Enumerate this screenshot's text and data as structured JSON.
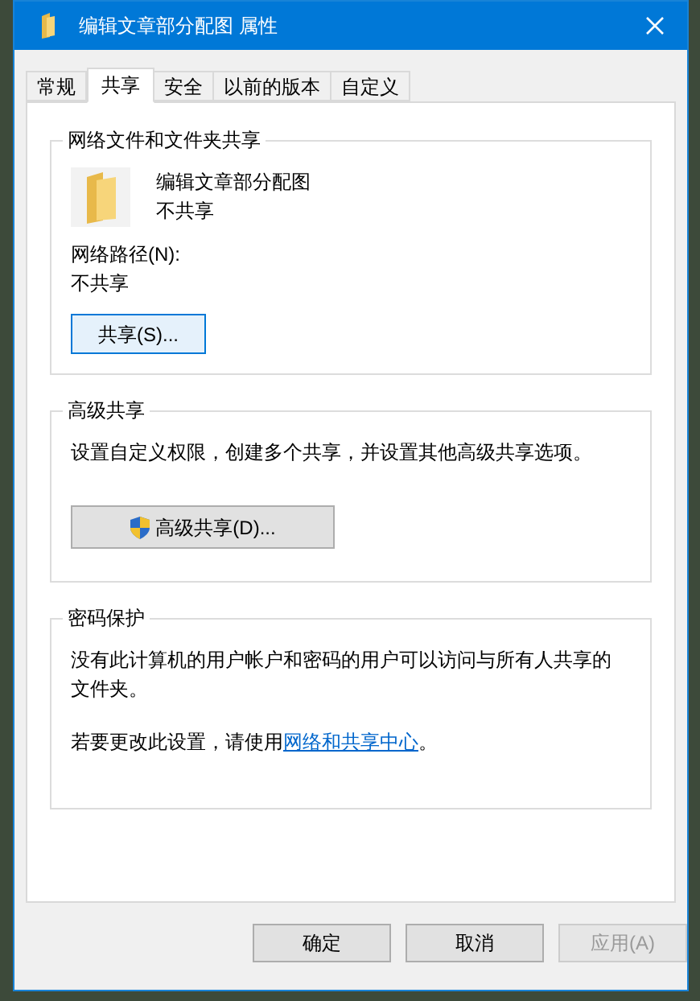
{
  "window": {
    "title": "编辑文章部分配图 属性"
  },
  "tabs": [
    {
      "label": "常规",
      "selected": false
    },
    {
      "label": "共享",
      "selected": true
    },
    {
      "label": "安全",
      "selected": false
    },
    {
      "label": "以前的版本",
      "selected": false
    },
    {
      "label": "自定义",
      "selected": false
    }
  ],
  "network_sharing": {
    "title": "网络文件和文件夹共享",
    "folder_name": "编辑文章部分配图",
    "folder_status": "不共享",
    "path_label": "网络路径(N):",
    "path_value": "不共享",
    "button": "共享(S)..."
  },
  "advanced_sharing": {
    "title": "高级共享",
    "description": "设置自定义权限，创建多个共享，并设置其他高级共享选项。",
    "button": "高级共享(D)..."
  },
  "password_protection": {
    "title": "密码保护",
    "description": "没有此计算机的用户帐户和密码的用户可以访问与所有人共享的文件夹。",
    "hint": "若要更改此设置，请使用",
    "link": "网络和共享中心",
    "hint_end": "。"
  },
  "buttons": [
    {
      "label": "确定",
      "disabled": false
    },
    {
      "label": "取消",
      "disabled": false
    },
    {
      "label": "应用(A)",
      "disabled": true
    }
  ]
}
